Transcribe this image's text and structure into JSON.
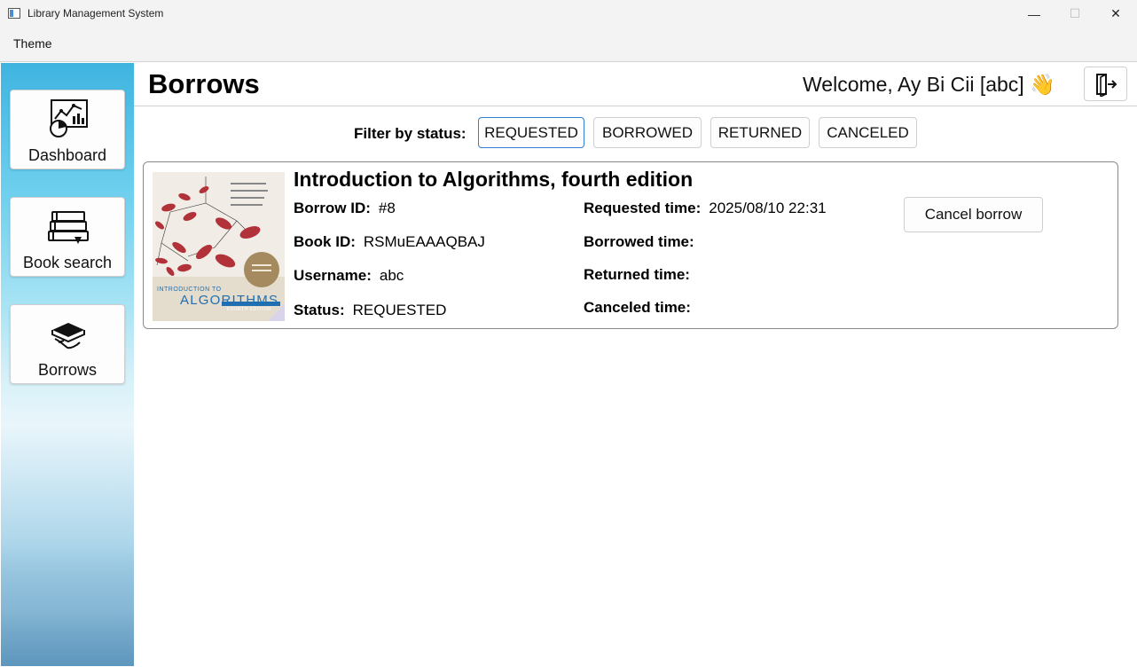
{
  "window": {
    "title": "Library Management System",
    "minimize_glyph": "—",
    "maximize_glyph": "☐",
    "close_glyph": "✕"
  },
  "menu": {
    "theme": "Theme"
  },
  "sidebar": {
    "items": [
      {
        "label": "Dashboard",
        "icon": "dashboard-chart-icon"
      },
      {
        "label": "Book search",
        "icon": "books-stack-icon"
      },
      {
        "label": "Borrows",
        "icon": "hand-book-icon"
      }
    ]
  },
  "header": {
    "title": "Borrows",
    "welcome": "Welcome, Ay Bi Cii [abc] 👋",
    "logout_icon": "logout-icon"
  },
  "filter": {
    "label": "Filter by status:",
    "options": [
      "REQUESTED",
      "BORROWED",
      "RETURNED",
      "CANCELED"
    ],
    "active": "REQUESTED"
  },
  "borrow": {
    "book_title": "Introduction to Algorithms, fourth edition",
    "borrow_id_label": "Borrow ID:",
    "borrow_id": "#8",
    "book_id_label": "Book ID:",
    "book_id": "RSMuEAAAQBAJ",
    "username_label": "Username:",
    "username": "abc",
    "status_label": "Status:",
    "status": "REQUESTED",
    "requested_label": "Requested time:",
    "requested_time": "2025/08/10 22:31",
    "borrowed_label": "Borrowed time:",
    "borrowed_time": "",
    "returned_label": "Returned time:",
    "returned_time": "",
    "canceled_label": "Canceled time:",
    "canceled_time": "",
    "cancel_button": "Cancel borrow",
    "cover": {
      "top_text": "INTRODUCTION TO",
      "main_text": "ALGORITHMS",
      "edition_text": "FOURTH EDITION",
      "accent_color": "#c0392b",
      "band_color": "#1f6fb2"
    }
  },
  "colors": {
    "active_border": "#2f7fd1",
    "card_border": "#8a8a8a"
  }
}
